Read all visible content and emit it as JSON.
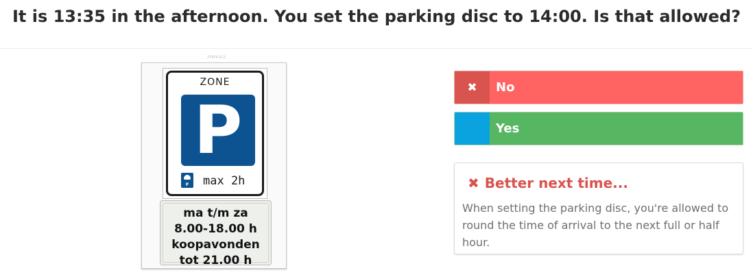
{
  "question": "It is 13:35 in the afternoon. You set the parking disc to 14:00. Is that allowed?",
  "image_caption": "ZTRFK-912",
  "sign": {
    "zone_text": "ZONE",
    "parking_symbol": "P",
    "disc_icon": "parking-disc-icon",
    "max_text": "max 2h",
    "sub_lines": [
      "ma t/m za",
      "8.00-18.00 h",
      "koopavonden",
      "tot 21.00 h"
    ]
  },
  "answers": [
    {
      "marker_icon": "cross-icon",
      "marker_glyph": "✖",
      "label": "No",
      "state": "selected-wrong"
    },
    {
      "marker_icon": "",
      "marker_glyph": "",
      "label": "Yes",
      "state": "correct"
    }
  ],
  "feedback": {
    "icon": "cross-icon",
    "icon_glyph": "✖",
    "title": "Better next time...",
    "text": "When setting the parking disc, you're allowed to round the time of arrival to the next full or half hour."
  },
  "colors": {
    "wrong": "#ff6462",
    "wrong_marker": "#d9534f",
    "correct": "#56b661",
    "correct_marker": "#0aa3e0",
    "sign_blue": "#0d5291"
  }
}
